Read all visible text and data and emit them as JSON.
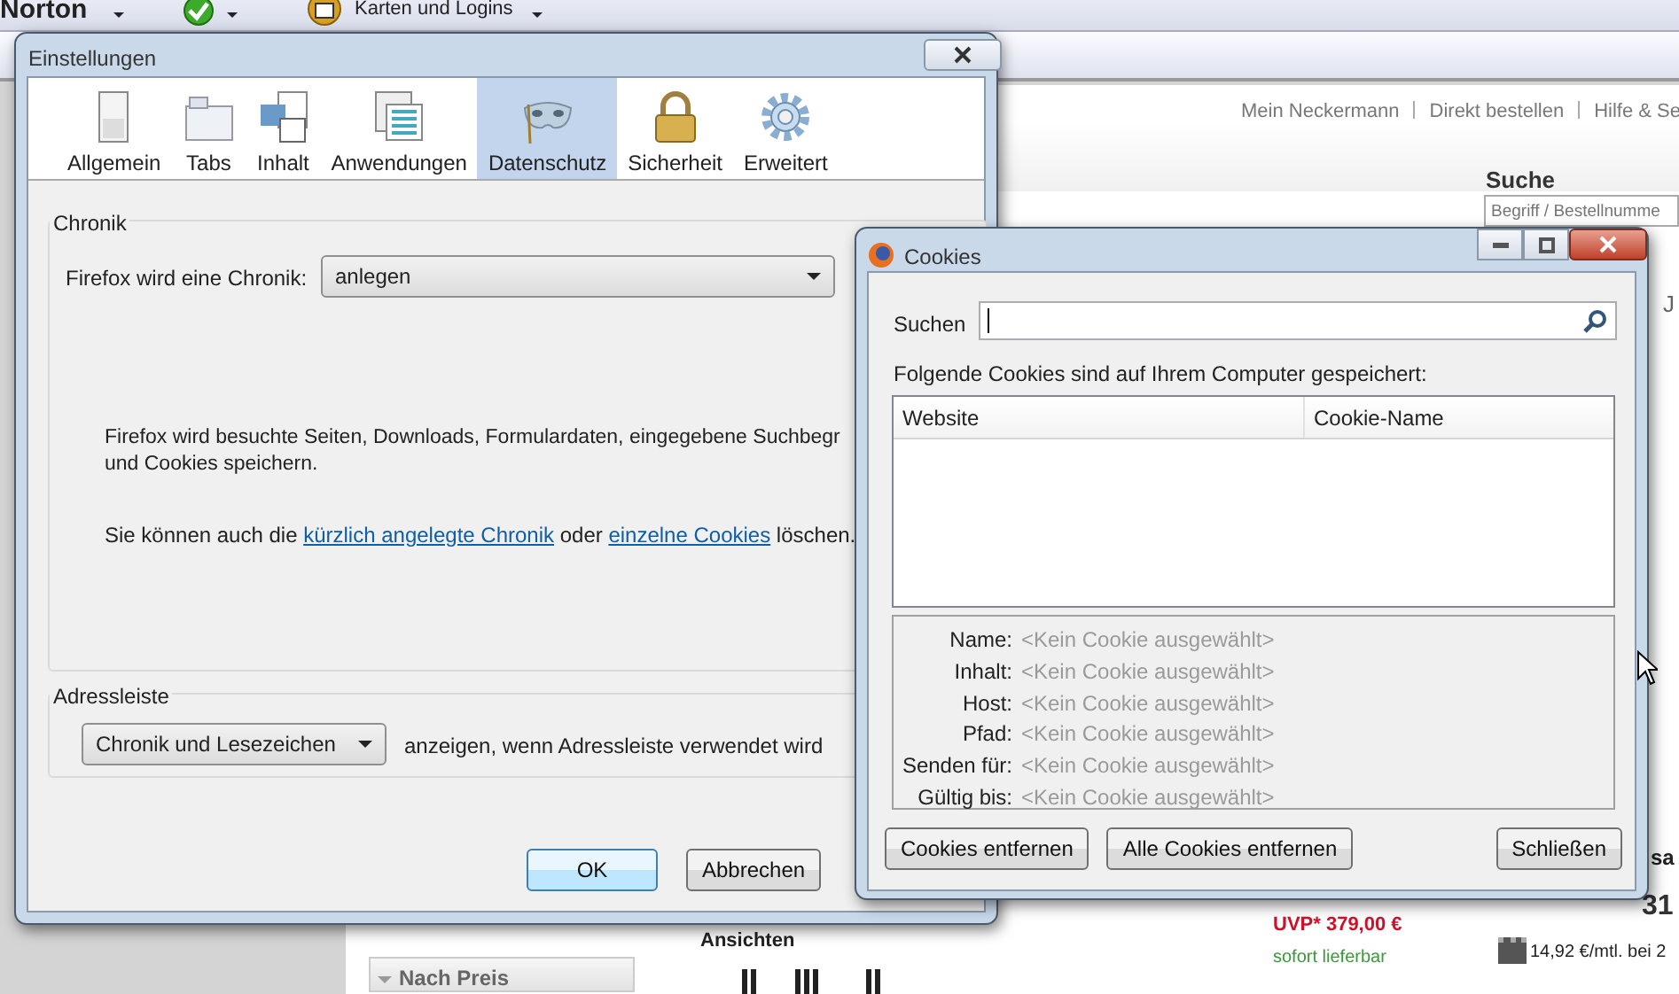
{
  "browser": {
    "toolbar": {
      "norton": "Norton",
      "logins": "Karten und Logins"
    },
    "top_links": [
      "Mein Neckermann",
      "Direkt bestellen",
      "Hilfe & Se"
    ],
    "search": {
      "title": "Suche",
      "placeholder": "Begriff / Bestellnumme"
    },
    "side_letter": "J",
    "filter": "Nach Preis",
    "views_title": "Ansichten",
    "product": {
      "name_fragment": "sa",
      "price_fragment": "31",
      "uvp": "UVP* 379,00 €",
      "availability": "sofort lieferbar",
      "financing": "14,92 €/mtl. bei 2"
    }
  },
  "settings_window": {
    "title": "Einstellungen",
    "tabs": [
      {
        "label": "Allgemein",
        "selected": false
      },
      {
        "label": "Tabs",
        "selected": false
      },
      {
        "label": "Inhalt",
        "selected": false
      },
      {
        "label": "Anwendungen",
        "selected": false
      },
      {
        "label": "Datenschutz",
        "selected": true
      },
      {
        "label": "Sicherheit",
        "selected": false
      },
      {
        "label": "Erweitert",
        "selected": false
      }
    ],
    "history": {
      "legend": "Chronik",
      "label": "Firefox wird eine Chronik:",
      "value": "anlegen",
      "description": [
        "Firefox wird besuchte Seiten, Downloads, Formulardaten, eingegebene Suchbegr",
        "und Cookies speichern."
      ],
      "clear_sentence": {
        "before": "Sie können auch die ",
        "link_history": "kürzlich angelegte Chronik",
        "middle": " oder ",
        "link_cookies": "einzelne Cookies",
        "after": " löschen."
      }
    },
    "address_bar": {
      "legend": "Adressleiste",
      "value": "Chronik und Lesezeichen",
      "suffix": "anzeigen, wenn Adressleiste verwendet wird"
    },
    "buttons": [
      {
        "label": "OK",
        "default": true
      },
      {
        "label": "Abbrechen",
        "default": false
      }
    ]
  },
  "cookies_window": {
    "title": "Cookies",
    "search_label": "Suchen",
    "intro": "Folgende Cookies sind auf Ihrem Computer gespeichert:",
    "columns": [
      "Website",
      "Cookie-Name"
    ],
    "details": [
      {
        "label": "Name:",
        "value": "<Kein Cookie ausgewählt>"
      },
      {
        "label": "Inhalt:",
        "value": "<Kein Cookie ausgewählt>"
      },
      {
        "label": "Host:",
        "value": "<Kein Cookie ausgewählt>"
      },
      {
        "label": "Pfad:",
        "value": "<Kein Cookie ausgewählt>"
      },
      {
        "label": "Senden für:",
        "value": "<Kein Cookie ausgewählt>"
      },
      {
        "label": "Gültig bis:",
        "value": "<Kein Cookie ausgewählt>"
      }
    ],
    "buttons": [
      "Cookies entfernen",
      "Alle Cookies entfernen",
      "Schließen"
    ]
  }
}
